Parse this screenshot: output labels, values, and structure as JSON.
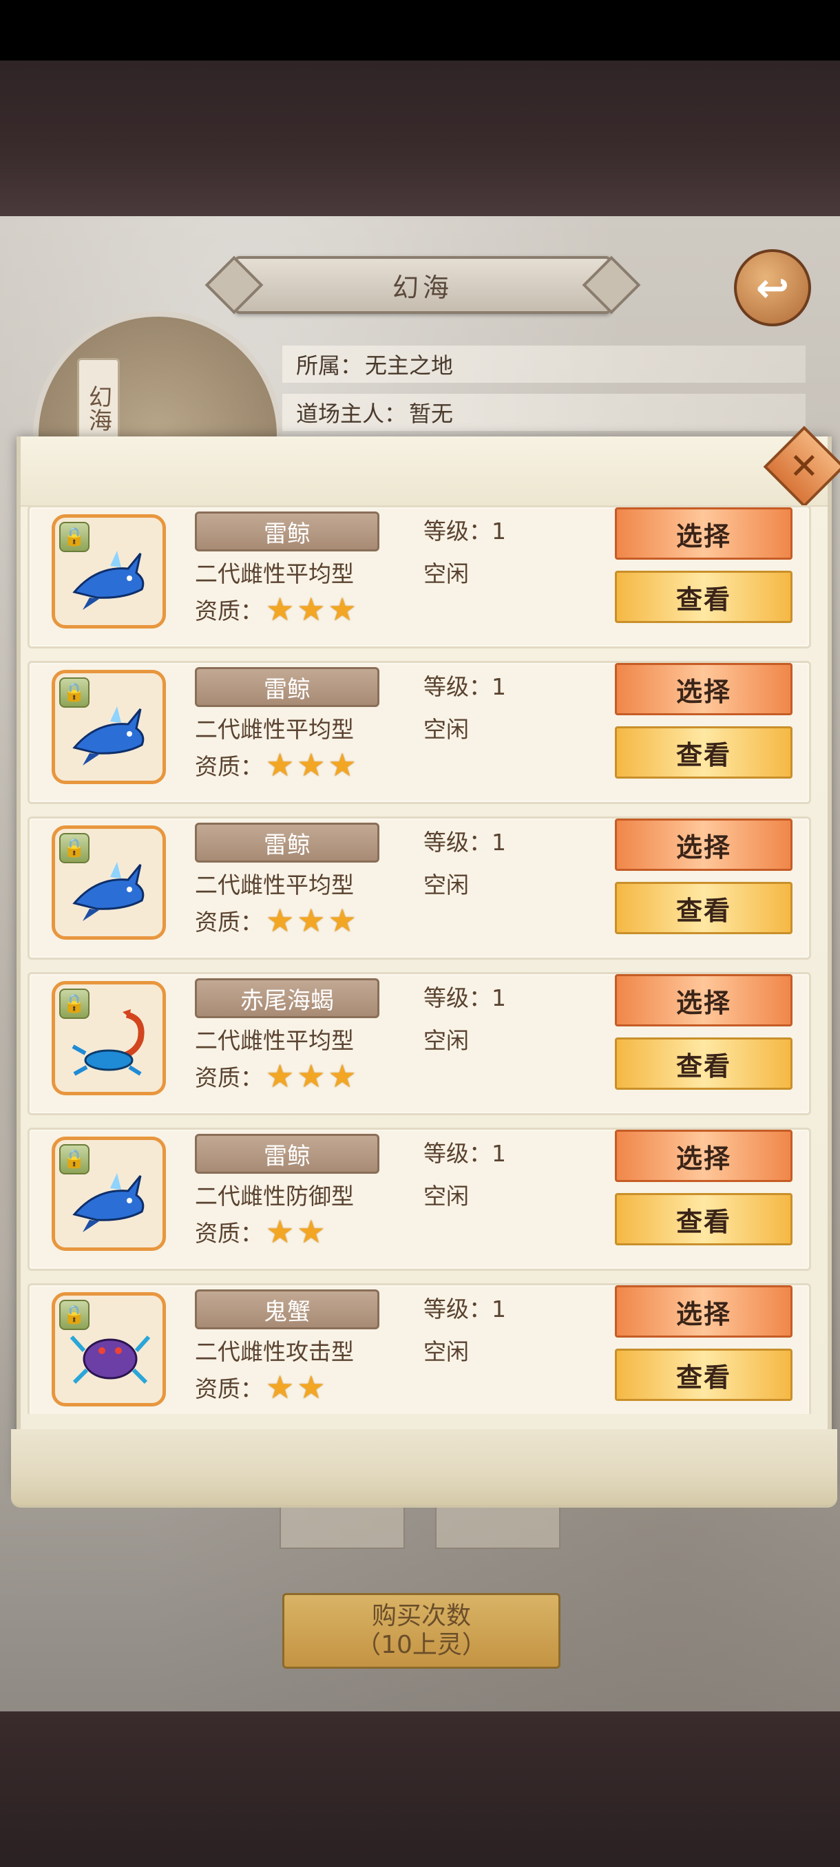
{
  "header": {
    "title": "幻海",
    "side_tag": "幻海",
    "owner_label": "所属：",
    "owner_value": "无主之地",
    "master_label": "道场主人：",
    "master_value": "暂无"
  },
  "buy_button": {
    "line1": "购买次数",
    "line2": "（10上灵）"
  },
  "pets": [
    {
      "name": "雷鲸",
      "type": "二代雌性平均型",
      "quality_label": "资质：",
      "stars": 3,
      "level_label": "等级：",
      "level": "1",
      "status": "空闲",
      "icon": "thunder-whale",
      "select_label": "选择",
      "view_label": "查看"
    },
    {
      "name": "雷鲸",
      "type": "二代雌性平均型",
      "quality_label": "资质：",
      "stars": 3,
      "level_label": "等级：",
      "level": "1",
      "status": "空闲",
      "icon": "thunder-whale",
      "select_label": "选择",
      "view_label": "查看"
    },
    {
      "name": "雷鲸",
      "type": "二代雌性平均型",
      "quality_label": "资质：",
      "stars": 3,
      "level_label": "等级：",
      "level": "1",
      "status": "空闲",
      "icon": "thunder-whale",
      "select_label": "选择",
      "view_label": "查看"
    },
    {
      "name": "赤尾海蝎",
      "type": "二代雌性平均型",
      "quality_label": "资质：",
      "stars": 3,
      "level_label": "等级：",
      "level": "1",
      "status": "空闲",
      "icon": "red-tail-scorpion",
      "select_label": "选择",
      "view_label": "查看"
    },
    {
      "name": "雷鲸",
      "type": "二代雌性防御型",
      "quality_label": "资质：",
      "stars": 2,
      "level_label": "等级：",
      "level": "1",
      "status": "空闲",
      "icon": "thunder-whale",
      "select_label": "选择",
      "view_label": "查看"
    },
    {
      "name": "鬼蟹",
      "type": "二代雌性攻击型",
      "quality_label": "资质：",
      "stars": 2,
      "level_label": "等级：",
      "level": "1",
      "status": "空闲",
      "icon": "ghost-crab",
      "select_label": "选择",
      "view_label": "查看"
    }
  ],
  "colors": {
    "select": "#f0874a",
    "view": "#f5b845",
    "avatar_border": "#e8963e",
    "star": "#f2a623"
  }
}
